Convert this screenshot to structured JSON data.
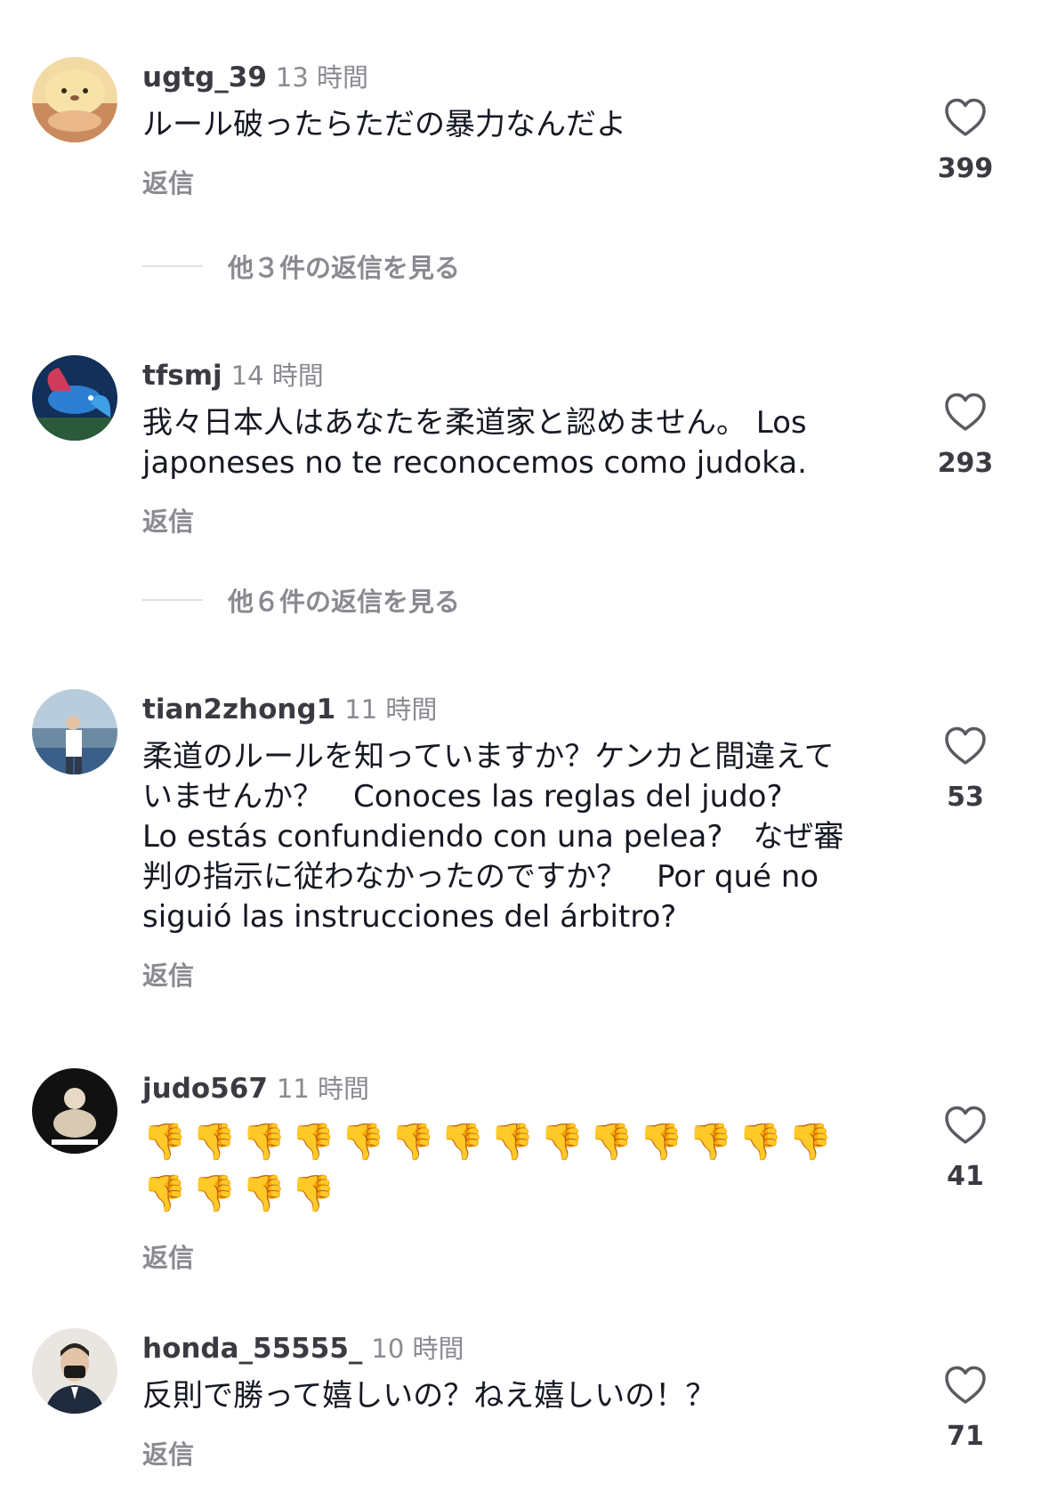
{
  "reply_label": "返信",
  "comments": [
    {
      "username": "ugtg_39",
      "time": "13 時間",
      "text": "ルール破ったらただの暴力なんだよ",
      "likes": "399",
      "view_more": "他３件の返信を見る"
    },
    {
      "username": "tfsmj",
      "time": "14 時間",
      "text": "我々日本人はあなたを柔道家と認めません。 Los\njaponeses no te reconocemos como judoka.",
      "likes": "293",
      "view_more": "他６件の返信を見る"
    },
    {
      "username": "tian2zhong1",
      "time": "11 時間",
      "text": "柔道のルールを知っていますか？ケンカと間違えて\nいませんか？　Conoces las reglas del judo?\nLo estás confundiendo con una pelea?　なぜ審\n判の指示に従わなかったのですか？　Por qué no\nsiguió las instrucciones del árbitro?",
      "likes": "53"
    },
    {
      "username": "judo567",
      "time": "11 時間",
      "text": "👎👎👎👎👎👎👎👎👎👎👎👎👎👎\n👎👎👎👎",
      "likes": "41"
    },
    {
      "username": "honda_55555_",
      "time": "10 時間",
      "text": "反則で勝って嬉しいの？ねえ嬉しいの！？",
      "likes": "71"
    }
  ],
  "icons": {
    "like": "heart-outline-icon"
  },
  "colors": {
    "username": "#3a3b42",
    "secondary": "#8a8b91",
    "text": "#161823"
  }
}
